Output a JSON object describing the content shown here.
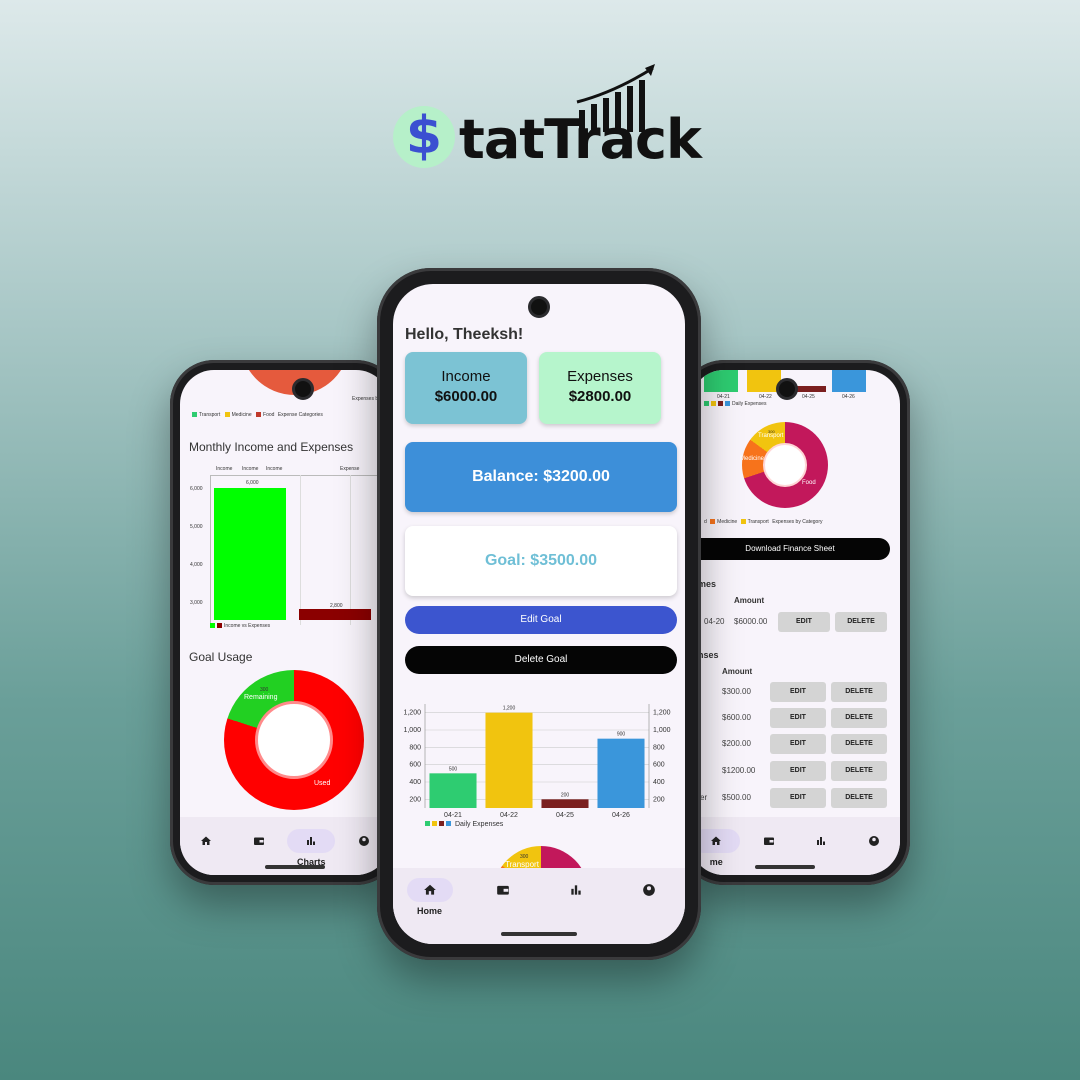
{
  "brand": {
    "logo_symbol": "$",
    "logo_text": "tatTrack",
    "colors": {
      "coin_bg": "#b6f0c9",
      "coin_symbol": "#3b4fd1",
      "text": "#111111"
    }
  },
  "center": {
    "greeting": "Hello, Theeksh!",
    "income": {
      "label": "Income",
      "value": "$6000.00",
      "color": "#7cc3d4"
    },
    "expenses": {
      "label": "Expenses",
      "value": "$2800.00",
      "color": "#b6f5cc"
    },
    "balance": "Balance: $3200.00",
    "goal": "Goal: $3500.00",
    "edit_goal": "Edit Goal",
    "delete_goal": "Delete Goal",
    "pie_label": "Transport",
    "pie_value": "300",
    "nav": {
      "home": "Home"
    }
  },
  "left": {
    "legend_top": [
      "Transport",
      "Medicine",
      "Food",
      "Expense Categories"
    ],
    "top_right_note": "Expenses by",
    "monthly_title": "Monthly Income and Expenses",
    "legend_income": "Income vs Expenses",
    "goal_title": "Goal Usage",
    "remaining_label": "Remaining",
    "remaining_value": "300",
    "used_label": "Used",
    "nav": {
      "charts": "Charts"
    },
    "bar_top_labels": [
      "Income",
      "Income",
      "Income",
      "Expense"
    ]
  },
  "right": {
    "daily_legend": "Daily Expenses",
    "x_labels": [
      "04-21",
      "04-22",
      "04-25",
      "04-26"
    ],
    "donut_labels": {
      "transport": "Transport",
      "medicine": "Medicine",
      "food": "Food",
      "value": "300"
    },
    "cat_legend": [
      "d",
      "Medicine",
      "Transport",
      "Expenses by Category"
    ],
    "download": "Download Finance Sheet",
    "incomes_title": "mes",
    "expenses_title": "nses",
    "amount_header": "Amount",
    "income_rows": [
      {
        "date": "04-20",
        "amount": "$6000.00"
      }
    ],
    "expense_rows": [
      {
        "amount": "$300.00"
      },
      {
        "amount": "$600.00"
      },
      {
        "amount": "$200.00"
      },
      {
        "amount": "$1200.00"
      },
      {
        "amount": "$500.00",
        "prefix": "er"
      }
    ],
    "edit": "EDIT",
    "delete": "DELETE",
    "nav": {
      "home": "me"
    }
  },
  "chart_data": [
    {
      "type": "bar",
      "title": "",
      "categories": [
        "04-21",
        "04-22",
        "04-25",
        "04-26"
      ],
      "values": [
        500,
        1200,
        200,
        900
      ],
      "value_labels": [
        "500",
        "1,200",
        "200",
        "900"
      ],
      "colors": [
        "#2ecc71",
        "#f1c40f",
        "#7b1f1f",
        "#3a96db"
      ],
      "series": [
        {
          "name": "Daily Expenses",
          "values": [
            500,
            1200,
            200,
            900
          ]
        }
      ],
      "yticks": [
        "200",
        "400",
        "600",
        "800",
        "1,000",
        "1,200"
      ],
      "ylim": [
        100,
        1300
      ],
      "legend": "bottom-left",
      "grid": true
    },
    {
      "type": "bar",
      "categories": [
        "Income",
        "Expense"
      ],
      "values": [
        6000,
        2800
      ],
      "value_labels": [
        "6,000",
        "2,800"
      ],
      "colors": [
        "#00ff00",
        "#8b0000"
      ],
      "yticks": [
        "3,000",
        "4,000",
        "5,000",
        "6,000"
      ],
      "series": [
        {
          "name": "Income vs Expenses",
          "values": [
            6000,
            2800
          ]
        }
      ],
      "legend": "bottom-left"
    },
    {
      "type": "pie",
      "title": "Goal Usage",
      "labels": [
        "Remaining",
        "Used"
      ],
      "values": [
        700,
        2800
      ],
      "colors": [
        "#22d022",
        "#ff0000"
      ]
    },
    {
      "type": "pie",
      "labels": [
        "Food",
        "Medicine",
        "Transport"
      ],
      "values": [
        1400,
        300,
        300
      ],
      "colors": [
        "#c2185b",
        "#f7731b",
        "#f1c40f"
      ]
    }
  ]
}
